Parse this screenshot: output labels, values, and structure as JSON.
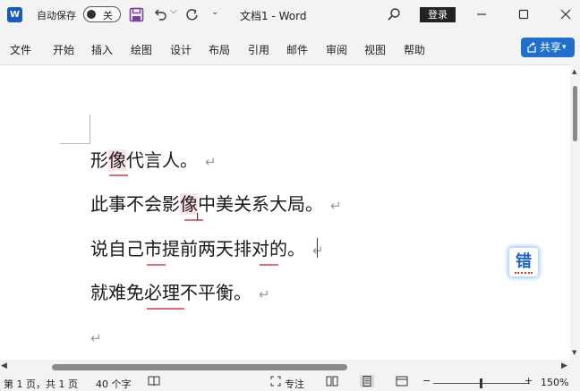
{
  "app": {
    "logo_letter": "W",
    "autosave_label": "自动保存",
    "autosave_state": "关",
    "title": "文档1 - Word",
    "signin_label": "登录"
  },
  "icons": {
    "save": "save-icon",
    "undo": "undo-icon",
    "redo": "redo-icon",
    "search": "search-icon",
    "minimize": "minimize-icon",
    "maximize": "maximize-icon",
    "close": "close-icon",
    "share": "share-icon"
  },
  "menu": {
    "tabs": [
      "文件",
      "开始",
      "插入",
      "绘图",
      "设计",
      "布局",
      "引用",
      "邮件",
      "审阅",
      "视图",
      "帮助"
    ],
    "share_label": "共享"
  },
  "document": {
    "lines": [
      "形像代言人。",
      "此事不会影像中美关系大局。",
      "说自己市提前两天排对的。",
      "就难免必理不平衡。",
      ""
    ],
    "paragraph_mark": "↵"
  },
  "spellcheck": {
    "button_label": "错"
  },
  "status": {
    "page_info": "第 1 页，共 1 页",
    "word_count": "40 个字",
    "focus_label": "专注",
    "zoom": "150%"
  },
  "colors": {
    "accent": "#185abd",
    "share_button": "#1f6fcf",
    "error_underline": "#e06a7a",
    "error_highlight": "#fbe3e6"
  }
}
